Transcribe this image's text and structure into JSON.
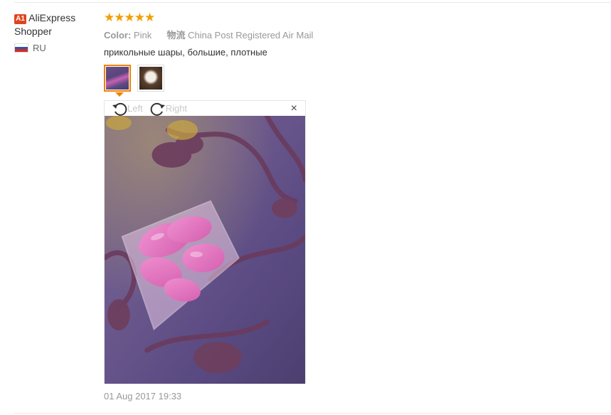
{
  "user": {
    "badge": "A1",
    "name": "AliExpress Shopper",
    "country": "RU",
    "flag_colors": [
      "#ffffff",
      "#2a55b5",
      "#d52b1e"
    ]
  },
  "review": {
    "stars": "★★★★★",
    "rating": 5,
    "color_label": "Color:",
    "color_value": "Pink",
    "shipping_label": "物流",
    "shipping_value": "China Post Registered Air Mail",
    "text": "прикольные шары, большие, плотные",
    "date": "01 Aug 2017 19:33"
  },
  "viewer": {
    "rotate_left_label": "Left",
    "rotate_right_label": "Right",
    "close_glyph": "×"
  },
  "colors": {
    "accent": "#f08200",
    "star": "#f0a000",
    "badge": "#e0441f"
  }
}
